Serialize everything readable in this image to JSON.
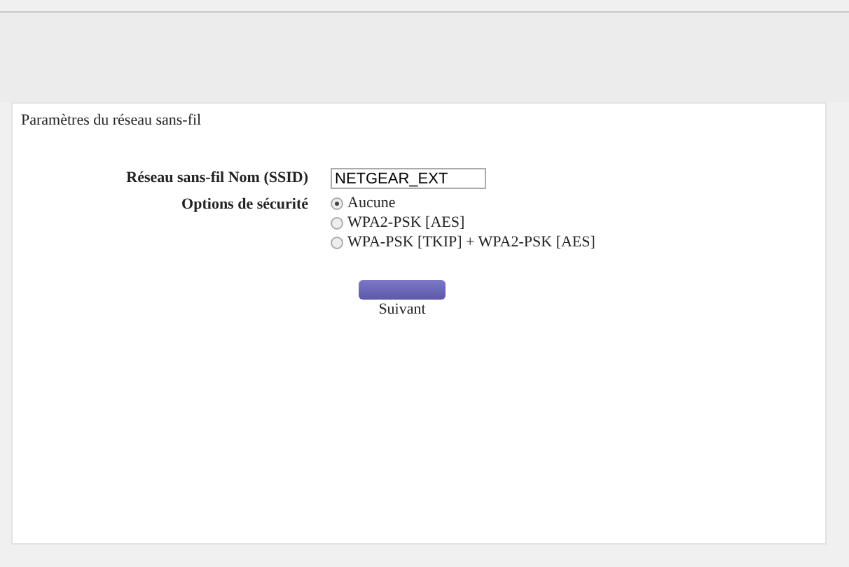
{
  "panel_title": "Paramètres du réseau sans-fil",
  "ssid": {
    "label": "Réseau sans-fil Nom (SSID)",
    "value": "NETGEAR_EXT"
  },
  "security": {
    "label": "Options de sécurité",
    "options": [
      {
        "label": "Aucune",
        "selected": true
      },
      {
        "label": "WPA2-PSK [AES]",
        "selected": false
      },
      {
        "label": "WPA-PSK [TKIP] + WPA2-PSK [AES]",
        "selected": false
      }
    ]
  },
  "next_button": {
    "label": "Suivant"
  }
}
